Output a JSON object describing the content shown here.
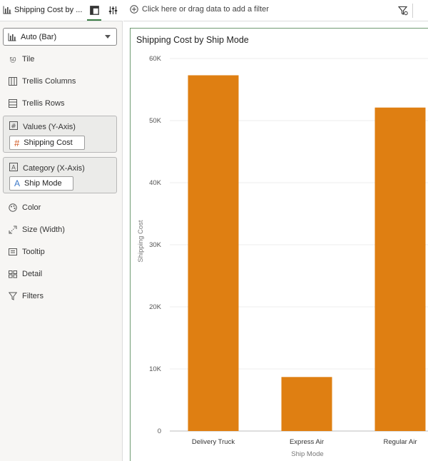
{
  "tab": {
    "title": "Shipping Cost by ..."
  },
  "chart_type_select": {
    "value": "Auto (Bar)"
  },
  "grammar": {
    "tile": "Tile",
    "trellis_columns": "Trellis Columns",
    "trellis_rows": "Trellis Rows",
    "values_zone": {
      "label": "Values (Y-Axis)",
      "pill": "Shipping Cost"
    },
    "category_zone": {
      "label": "Category (X-Axis)",
      "pill": "Ship Mode"
    },
    "color": "Color",
    "size": "Size (Width)",
    "tooltip": "Tooltip",
    "detail": "Detail",
    "filters": "Filters"
  },
  "filter_bar": {
    "placeholder": "Click here or drag data to add a filter"
  },
  "colors": {
    "bar": "#df7f12",
    "accent": "#3a7d44"
  },
  "chart_data": {
    "type": "bar",
    "title": "Shipping Cost by Ship Mode",
    "xlabel": "Ship Mode",
    "ylabel": "Shipping Cost",
    "categories": [
      "Delivery Truck",
      "Express Air",
      "Regular Air"
    ],
    "values": [
      57300,
      8700,
      52100
    ],
    "ylim": [
      0,
      60000
    ],
    "yticks": [
      0,
      10000,
      20000,
      30000,
      40000,
      50000,
      60000
    ],
    "ytick_labels": [
      "0",
      "10K",
      "20K",
      "30K",
      "40K",
      "50K",
      "60K"
    ],
    "grid": true
  }
}
